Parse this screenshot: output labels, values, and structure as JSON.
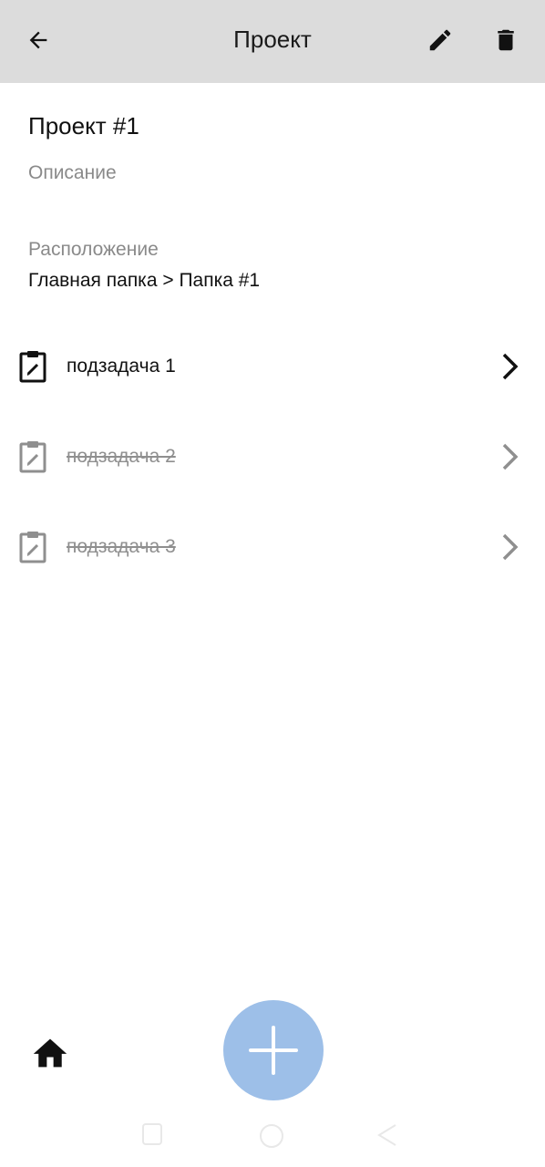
{
  "appbar": {
    "title": "Проект"
  },
  "project": {
    "name": "Проект #1",
    "description_placeholder": "Описание",
    "location_label": "Расположение",
    "location_value": "Главная папка > Папка #1"
  },
  "subtasks": [
    {
      "label": "подзадача 1",
      "completed": false
    },
    {
      "label": "подзадача 2",
      "completed": true
    },
    {
      "label": "подзадача 3",
      "completed": true
    }
  ],
  "colors": {
    "appbar_bg": "#dcdcdc",
    "fab_bg": "#9dbfe8",
    "muted_text": "#8a8a8a"
  },
  "icons": [
    "back-arrow-icon",
    "edit-pencil-icon",
    "trash-icon",
    "clipboard-edit-icon",
    "chevron-right-icon",
    "home-icon",
    "plus-icon"
  ]
}
